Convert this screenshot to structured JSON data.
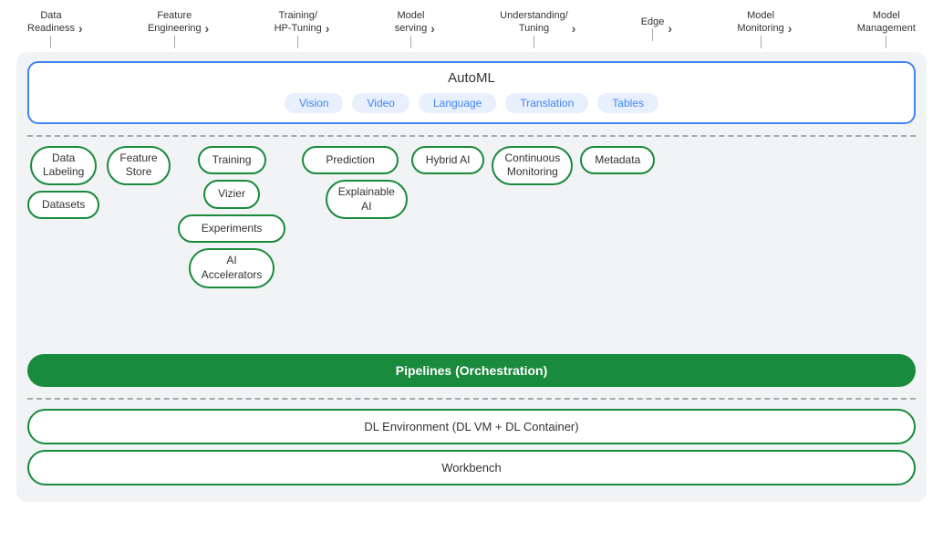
{
  "nav": {
    "items": [
      {
        "label": "Data\nReadiness",
        "id": "data-readiness"
      },
      {
        "label": "Feature\nEngineering",
        "id": "feature-engineering"
      },
      {
        "label": "Training/\nHP-Tuning",
        "id": "training-hp-tuning"
      },
      {
        "label": "Model\nserving",
        "id": "model-serving"
      },
      {
        "label": "Understanding/\nTuning",
        "id": "understanding-tuning"
      },
      {
        "label": "Edge",
        "id": "edge"
      },
      {
        "label": "Model\nMonitoring",
        "id": "model-monitoring"
      },
      {
        "label": "Model\nManagement",
        "id": "model-management"
      }
    ]
  },
  "automl": {
    "title": "AutoML",
    "pills": [
      "Vision",
      "Video",
      "Language",
      "Translation",
      "Tables"
    ]
  },
  "components": {
    "row1": [
      {
        "label": "Data\nLabeling",
        "id": "data-labeling"
      },
      {
        "label": "Feature\nStore",
        "id": "feature-store"
      },
      {
        "label": "Training",
        "id": "training"
      },
      {
        "label": "Prediction",
        "id": "prediction"
      },
      {
        "label": "Hybrid AI",
        "id": "hybrid-ai"
      },
      {
        "label": "Continuous\nMonitoring",
        "id": "continuous-monitoring"
      },
      {
        "label": "Metadata",
        "id": "metadata"
      }
    ],
    "row2": [
      {
        "label": "Datasets",
        "id": "datasets"
      },
      {
        "label": "Vizier",
        "id": "vizier"
      },
      {
        "label": "Explainable\nAI",
        "id": "explainable-ai"
      }
    ],
    "row3": [
      {
        "label": "Experiments",
        "id": "experiments"
      }
    ],
    "row4": [
      {
        "label": "AI\nAccelerators",
        "id": "ai-accelerators"
      }
    ]
  },
  "pipelines": {
    "label": "Pipelines (Orchestration)"
  },
  "bottom": {
    "dl_environment": "DL Environment (DL VM + DL Container)",
    "workbench": "Workbench"
  },
  "colors": {
    "green": "#1a8a3c",
    "blue": "#4285f4",
    "blue_light": "#e8f0fe",
    "gray_bg": "#f1f3f4",
    "dashed": "#aaa",
    "text": "#333"
  }
}
